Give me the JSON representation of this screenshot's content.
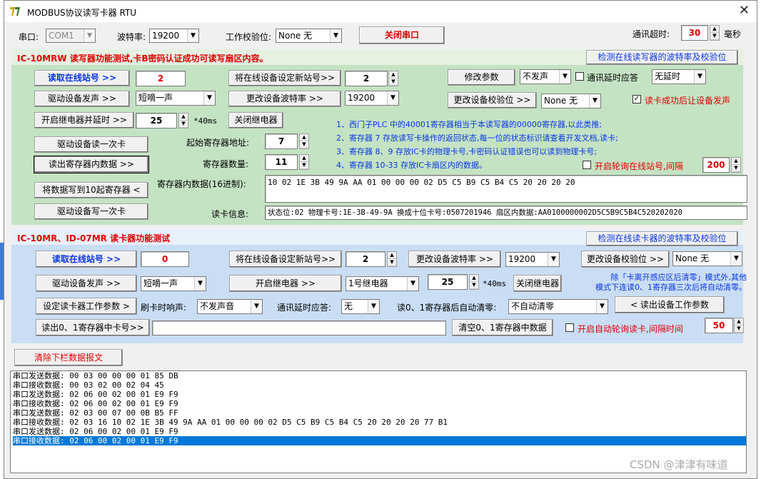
{
  "window": {
    "title": "MODBUS协议读写卡器 RTU",
    "close": "✕",
    "icon": "app-icon"
  },
  "topbar": {
    "port_label": "串口:",
    "port_value": "COM1",
    "baud_label": "波特率:",
    "baud_value": "19200",
    "parity_label": "工作校验位:",
    "parity_value": "None  无",
    "close_port_button": "关闭串口",
    "timeout_label": "通讯超时:",
    "timeout_value": "30",
    "timeout_unit": "毫秒"
  },
  "writer_panel": {
    "title": "IC-10MRW 读写器功能测试,卡B密码认证成功可读写扇区内容。",
    "detect_button": "检测在线读写器的波特率及校验位",
    "read_station_button": "读取在线站号 >>",
    "station_value": "2",
    "set_station_button": "将在线设备设定新站号>>",
    "new_station_value": "2",
    "modify_params_button": "修改参数",
    "sound_select": "不发声",
    "delay_checkbox_label": "通讯延时应答",
    "delay_select": "无延时",
    "drive_sound_button": "驱动设备发声 >>",
    "beep_select": "短嘀一声",
    "change_baud_button": "更改设备波特率 >>",
    "baud_select": "19200",
    "change_parity_button": "更改设备校验位 >>",
    "parity_select": "None  无",
    "read_success_checkbox_label": "读卡成功后让设备发声",
    "relay_button": "开启继电器并延时 >>",
    "relay_delay_value": "25",
    "relay_unit": "*40ms",
    "close_relay_button": "关闭继电器",
    "start_reg_label": "起始寄存器地址:",
    "start_reg_value": "7",
    "reg_count_label": "寄存器数量:",
    "reg_count_value": "11",
    "read_once_button": "驱动设备读一次卡",
    "read_regs_button": "读出寄存器内数据 >>",
    "write_regs_button": "将数据写到10起寄存器 <",
    "write_once_button": "驱动设备写一次卡",
    "info_lines": [
      "1、西门子PLC 中的40001寄存器相当于本读写器的00000寄存器,以此类推;",
      "2、寄存器 7 存放读写卡操作的返回状态,每一位的状态标识请查看开发文档,读卡;",
      "3、寄存器 8、9 存放IC卡的物理卡号,卡密码认证错误也可以读到物理卡号;",
      "4、寄存器 10-33 存放IC卡扇区内的数据。"
    ],
    "poll_checkbox_label": "开启轮询在线站号,间隔",
    "poll_interval_value": "200",
    "reg_data_label": "寄存器内数据(16进制):",
    "reg_data_value": "10 02 1E 3B 49 9A AA 01 00 00 00 02 D5 C5 B9 C5 B4 C5 20 20 20 20",
    "card_info_label": "读卡信息:",
    "card_info_value": "状态位:02 物理卡号:1E-3B-49-9A 换成十位卡号:0507201946 扇区内数据:AA0100000002D5C5B9C5B4C520202020"
  },
  "reader_panel": {
    "title": "IC-10MR、ID-07MR 读卡器功能测试",
    "detect_button": "检测在线读卡器的波特率及校验位",
    "read_station_button": "读取在线站号 >>",
    "station_value": "0",
    "set_station_button": "将在线设备设定新站号>>",
    "new_station_value": "2",
    "change_baud_button": "更改设备波特率 >>",
    "baud_select": "19200",
    "change_parity_button": "更改设备校验位 >>",
    "parity_select": "None  无",
    "drive_sound_button": "驱动设备发声 >>",
    "beep_select": "短嘀一声",
    "relay_button": "开启继电器 >>",
    "relay_select": "1号继电器",
    "relay_delay_value": "25",
    "relay_unit": "*40ms",
    "close_relay_button": "关闭继电器",
    "note_line1": "除「卡离开感应区后清零」模式外,其他",
    "note_line2": "模式下连读0、1寄存器三次后将自动清零。",
    "set_params_button": "设定读卡器工作参数 >",
    "swipe_sound_label": "刷卡时响声:",
    "swipe_sound_select": "不发声音",
    "delay_label": "通讯延时应答:",
    "delay_select": "无",
    "autoclear_label": "读0、1寄存器后自动清零:",
    "autoclear_select": "不自动清零",
    "read_params_button": "< 读出设备工作参数",
    "read_card_button": "读出0、1寄存器中卡号>>",
    "card_value": "",
    "clear_regs_button": "清空0、1寄存器中数据",
    "auto_poll_checkbox_label": "开启自动轮询读卡,间隔时间",
    "auto_poll_value": "50"
  },
  "log": {
    "clear_button": "清除下栏数据报文",
    "lines": [
      "串口发送数据: 00 03 00 00 00 01 85 DB",
      "串口接收数据: 00 03 02 00 02 04 45",
      "串口发送数据: 02 06 00 02 00 01 E9 F9",
      "串口接收数据: 02 06 00 02 00 01 E9 F9",
      "串口发送数据: 02 03 00 07 00 0B B5 FF",
      "串口接收数据: 02 03 16 10 02 1E 3B 49 9A AA 01 00 00 00 02 D5 C5 B9 C5 B4 C5 20 20 20 20 77 B1",
      "串口发送数据: 02 06 00 02 00 01 E9 F9",
      "串口接收数据: 02 06 00 02 00 01 E9 F9"
    ]
  },
  "watermark": "CSDN @津津有味道",
  "colors": {
    "accent_blue": "#0b36e6",
    "accent_red": "#e00000",
    "writer_bg": "#c4e3c3",
    "reader_bg": "#c9def5",
    "selected_row": "#0078d7"
  }
}
